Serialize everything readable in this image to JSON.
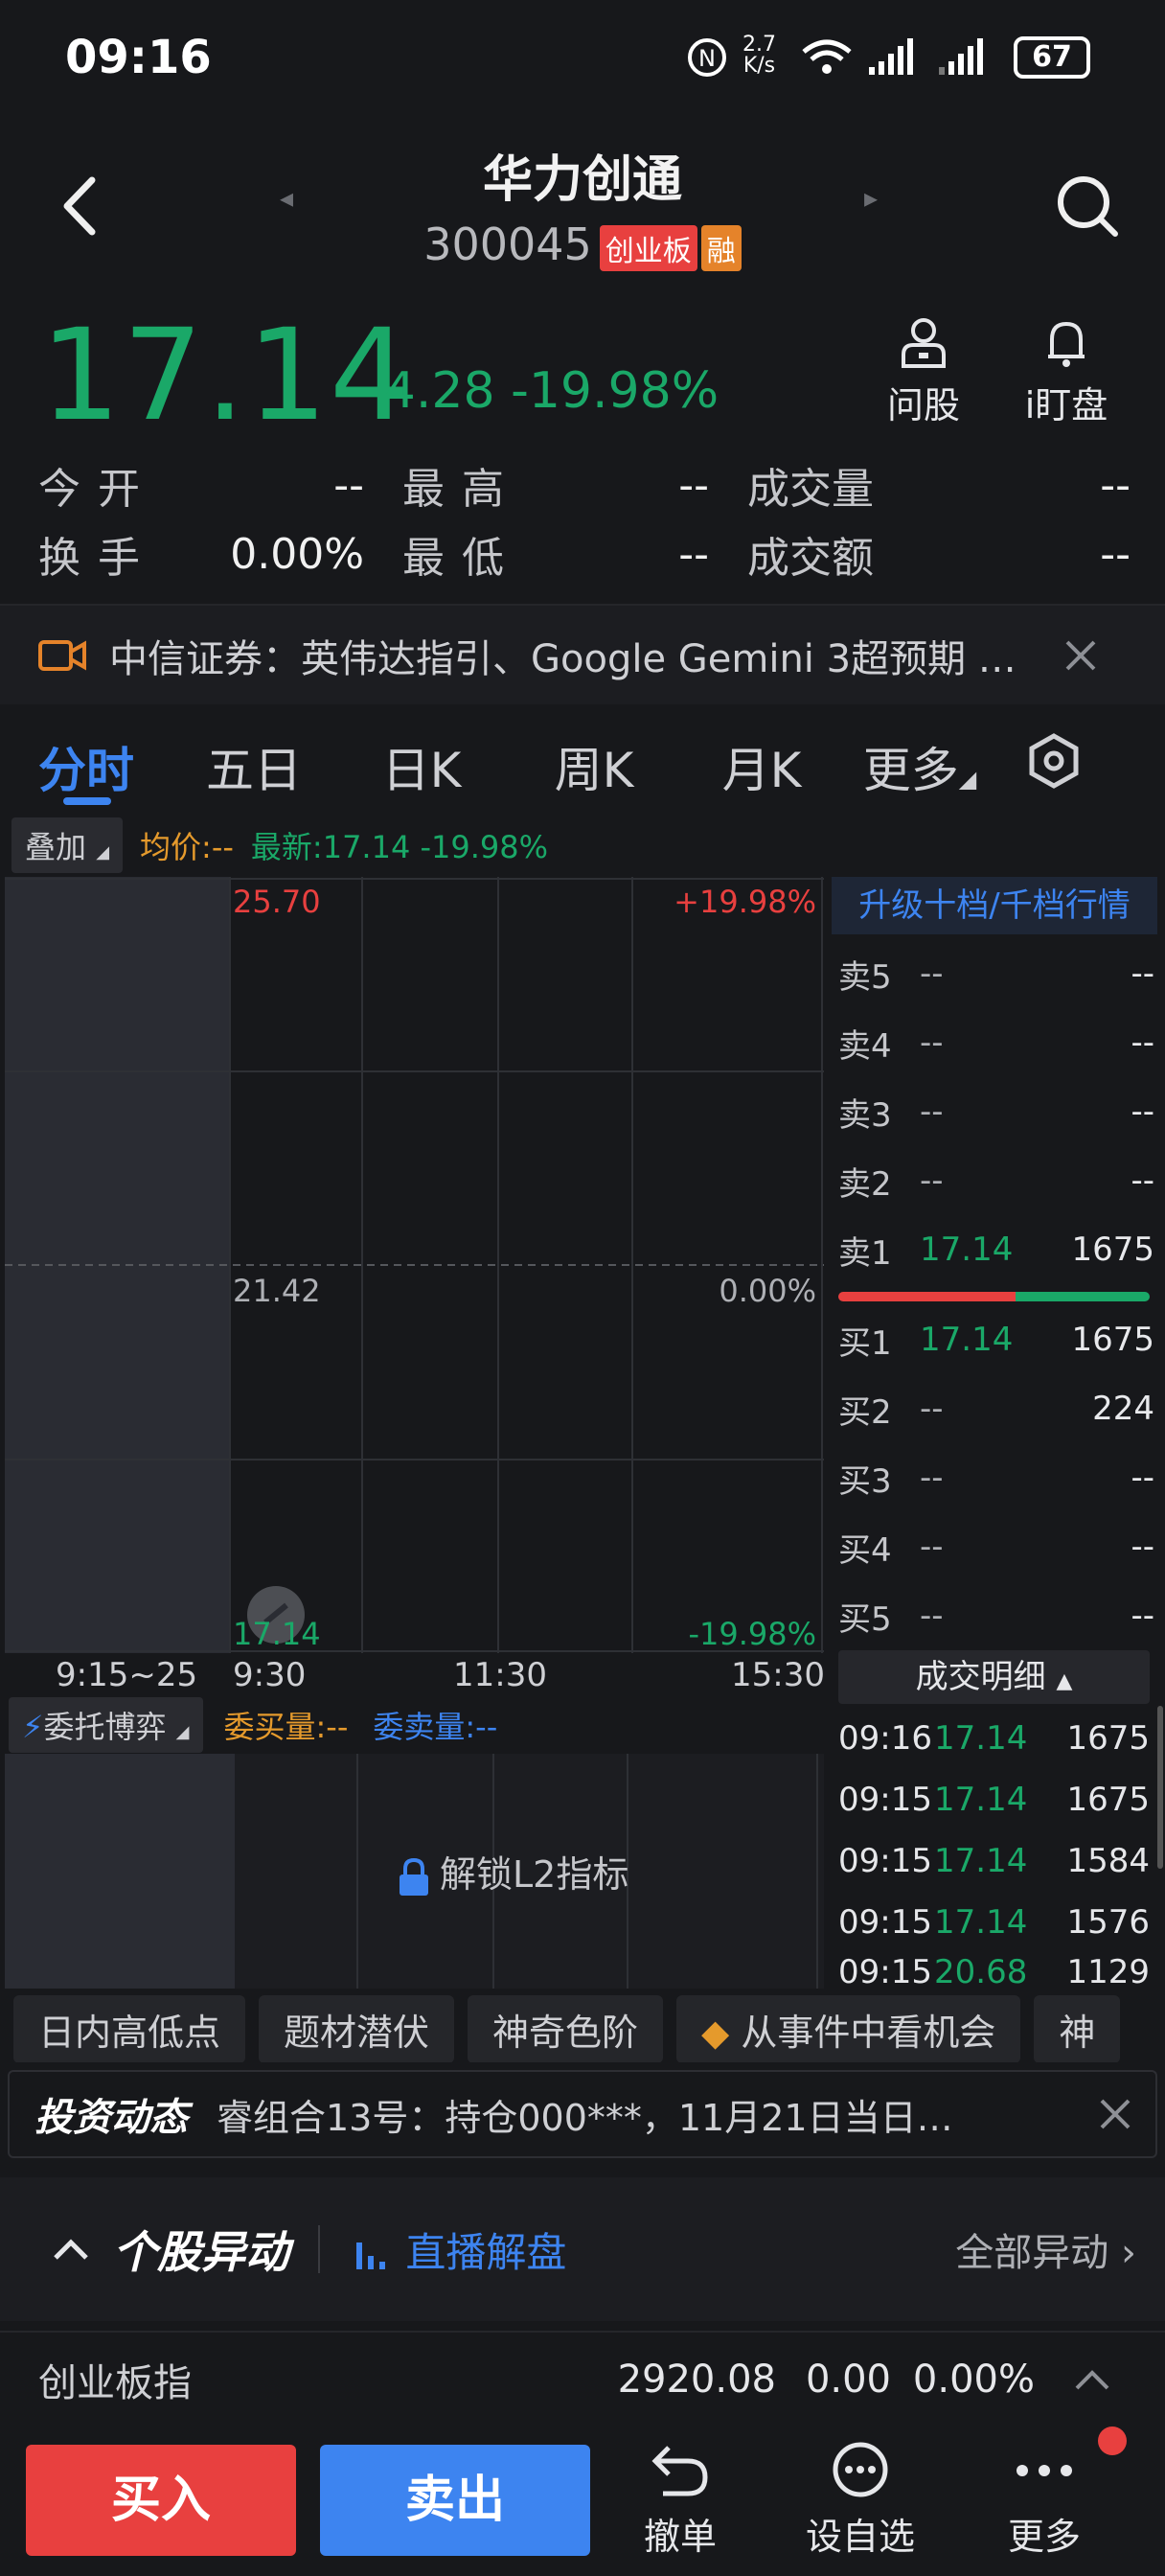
{
  "status": {
    "time": "09:16",
    "net_speed_top": "2.7",
    "net_speed_unit": "K/s",
    "battery": "67"
  },
  "header": {
    "name": "华力创通",
    "code": "300045",
    "tag_board": "创业板",
    "tag_margin": "融",
    "ask_label": "问股",
    "watch_label": "i盯盘"
  },
  "quote": {
    "price": "17.14",
    "change": "-4.28",
    "change_pct": "-19.98%"
  },
  "stats": {
    "open_label": "今开",
    "open": "--",
    "high_label": "最高",
    "high": "--",
    "vol_label": "成交量",
    "vol": "--",
    "turnover_label": "换手",
    "turnover": "0.00%",
    "low_label": "最低",
    "low": "--",
    "amt_label": "成交额",
    "amt": "--"
  },
  "banner": {
    "text": "中信证券：英伟达指引、Google Gemini 3超预期 …"
  },
  "tabs": [
    "分时",
    "五日",
    "日K",
    "周K",
    "月K",
    "更多"
  ],
  "subbar": {
    "overlay": "叠加",
    "avg": "均价:--",
    "latest": "最新:17.14 -19.98%"
  },
  "chart": {
    "top_price": "25.70",
    "top_pct": "+19.98%",
    "mid_price": "21.42",
    "mid_pct": "0.00%",
    "low_price": "17.14",
    "low_pct": "-19.98%",
    "times": [
      "9:15~25",
      "9:30",
      "11:30",
      "15:30"
    ]
  },
  "book": {
    "upgrade": "升级十档/千档行情",
    "asks": [
      {
        "label": "卖5",
        "price": "--",
        "vol": "--"
      },
      {
        "label": "卖4",
        "price": "--",
        "vol": "--"
      },
      {
        "label": "卖3",
        "price": "--",
        "vol": "--"
      },
      {
        "label": "卖2",
        "price": "--",
        "vol": "--"
      },
      {
        "label": "卖1",
        "price": "17.14",
        "vol": "1675"
      }
    ],
    "bids": [
      {
        "label": "买1",
        "price": "17.14",
        "vol": "1675"
      },
      {
        "label": "买2",
        "price": "--",
        "vol": "224"
      },
      {
        "label": "买3",
        "price": "--",
        "vol": "--"
      },
      {
        "label": "买4",
        "price": "--",
        "vol": "--"
      },
      {
        "label": "买5",
        "price": "--",
        "vol": "--"
      }
    ]
  },
  "trades": {
    "header": "成交明细",
    "rows": [
      {
        "time": "09:16",
        "price": "17.14",
        "vol": "1675"
      },
      {
        "time": "09:15",
        "price": "17.14",
        "vol": "1675"
      },
      {
        "time": "09:15",
        "price": "17.14",
        "vol": "1584"
      },
      {
        "time": "09:15",
        "price": "17.14",
        "vol": "1576"
      },
      {
        "time": "09:15",
        "price": "20.68",
        "vol": "1129"
      }
    ]
  },
  "subchart": {
    "title": "委托博弈",
    "buy": "委买量:--",
    "sell": "委卖量:--",
    "unlock": "解锁L2指标"
  },
  "chips": [
    "日内高低点",
    "题材潜伏",
    "神奇色阶",
    "从事件中看机会",
    "神"
  ],
  "dynamic": {
    "logo": "投资动态",
    "text": "睿组合13号：持仓000***，11月21日当日…"
  },
  "anomaly": {
    "title": "个股异动",
    "live": "直播解盘",
    "all": "全部异动"
  },
  "index": {
    "name": "创业板指",
    "value": "2920.08",
    "change": "0.00",
    "pct": "0.00%"
  },
  "bottom": {
    "buy": "买入",
    "sell": "卖出",
    "cancel": "撤单",
    "fav": "设自选",
    "more": "更多"
  }
}
